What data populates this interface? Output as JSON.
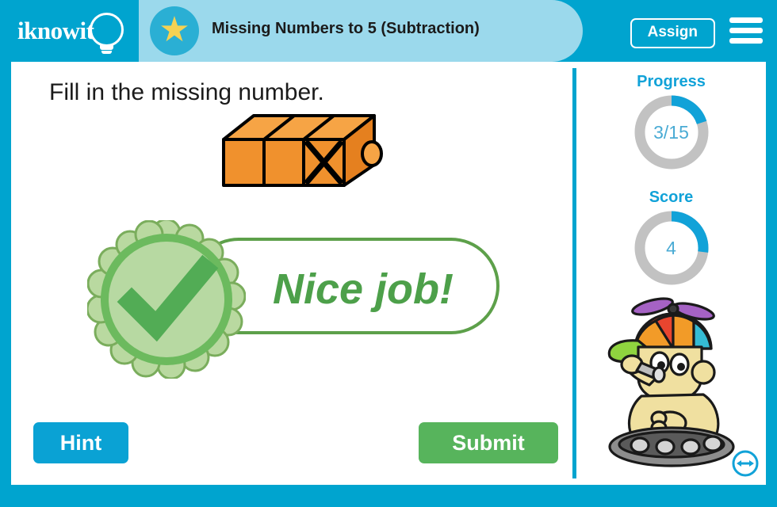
{
  "app": {
    "brand": "iknowit",
    "frame_color": "#00a4cf",
    "accent_color": "#11a2d8"
  },
  "header": {
    "logo_text": "iknowit",
    "logo_icon": "lightbulb-icon",
    "star_icon": "star-icon",
    "title": "Missing Numbers to 5 (Subtraction)",
    "assign_label": "Assign",
    "menu_icon": "hamburger-menu-icon"
  },
  "main": {
    "question": "Fill in the missing number.",
    "graphic": {
      "name": "orange-block-group",
      "total_units": 3,
      "crossed_out_units": 1,
      "fill_color": "#f0912d",
      "top_color": "#f6a445",
      "side_color": "#e5801f",
      "outline_color": "#000000"
    },
    "feedback": {
      "message": "Nice job!",
      "icon": "check-mark-badge-icon",
      "color": "#4da04a",
      "border_color": "#5da04a"
    },
    "hint_label": "Hint",
    "hint_color": "#0aa2d4",
    "submit_label": "Submit",
    "submit_color": "#57b45c"
  },
  "sidebar": {
    "progress": {
      "label": "Progress",
      "value": "3/15",
      "completed": 3,
      "total": 15,
      "percent": 20,
      "arc_color": "#11a2d8",
      "track_color": "#c2c2c2"
    },
    "score": {
      "label": "Score",
      "value": "4",
      "percent": 27,
      "arc_color": "#11a2d8",
      "track_color": "#c2c2c2"
    },
    "mascot": {
      "name": "robot-mascot-avatar",
      "description": "robot with propeller beanie on tank treads"
    },
    "resize_icon": "resize-horizontal-icon"
  }
}
